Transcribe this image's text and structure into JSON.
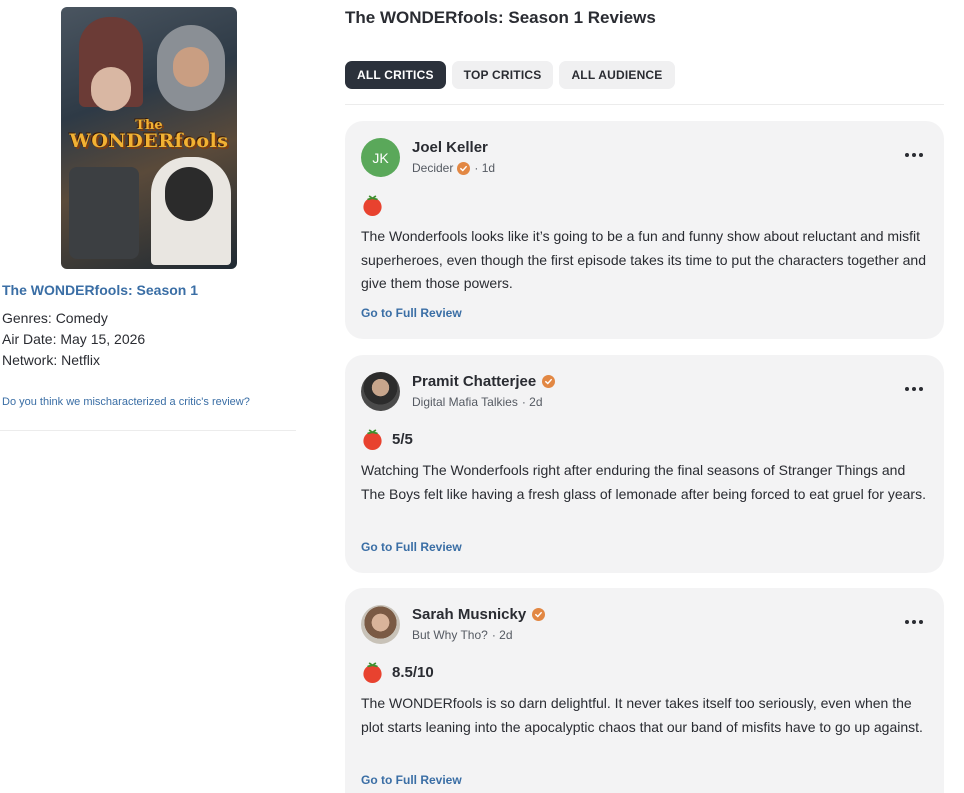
{
  "poster": {
    "title_small": "The",
    "title_main": "WONDERfools"
  },
  "show": {
    "title": "The WONDERfools: Season 1",
    "genres": "Genres: Comedy",
    "air_date": "Air Date: May 15, 2026",
    "network": "Network: Netflix",
    "feedback_link": "Do you think we mischaracterized a critic's review?"
  },
  "page": {
    "title": "The WONDERfools: Season 1 Reviews"
  },
  "filters": [
    "ALL CRITICS",
    "TOP CRITICS",
    "ALL AUDIENCE"
  ],
  "active_filter": "ALL CRITICS",
  "reviews": [
    {
      "avatar_text": "JK",
      "critic": "Joel Keller",
      "publication": "Decider",
      "age": "· 1d",
      "score": "",
      "quote": "The Wonderfools looks like it’s going to be a fun and funny show about reluctant and misfit superheroes, even though the first episode takes its time to put the characters together and give them those powers.",
      "link": "Go to Full Review"
    },
    {
      "avatar_text": "",
      "critic": "Pramit Chatterjee",
      "publication": "Digital Mafia Talkies",
      "age": "· 2d",
      "score": "5/5",
      "quote": "Watching The Wonderfools right after enduring the final seasons of Stranger Things and The Boys felt like having a fresh glass of lemonade after being forced to eat gruel for years.",
      "link": "Go to Full Review"
    },
    {
      "avatar_text": "",
      "critic": "Sarah Musnicky",
      "publication": "But Why Tho?",
      "age": "· 2d",
      "score": "8.5/10",
      "quote": "The WONDERfools is so darn delightful. It never takes itself too seriously, even when the plot starts leaning into the apocalyptic chaos that our band of misfits have to go up against.",
      "link": "Go to Full Review"
    }
  ],
  "colors": {
    "accent": "#3a6ea5",
    "active_chip": "#2b313b",
    "verified": "#e28743",
    "tomato": "#e8422f"
  }
}
